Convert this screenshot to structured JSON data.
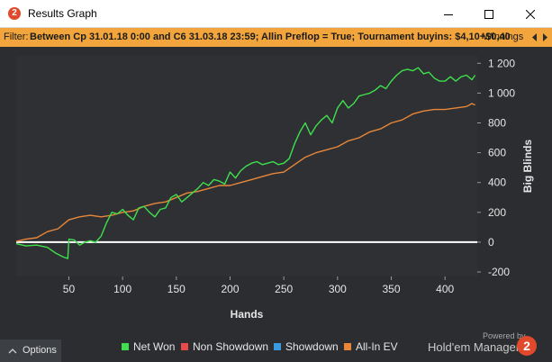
{
  "window": {
    "title": "Results Graph",
    "logo_text": "2"
  },
  "filter": {
    "label": "Filter:",
    "text": "Between Cp 31.01.18 0:00 and C6 31.03.18 23:59; Allin Preflop = True; Tournament buyins: $4,10+$0,40",
    "extra": "Winnings"
  },
  "footer": {
    "options_label": "Options",
    "powered_by": "Powered by",
    "brand": "Hold'em Manager",
    "brand_logo_text": "2",
    "legend": [
      {
        "label": "Net Won",
        "color": "#3ee04d"
      },
      {
        "label": "Non Showdown",
        "color": "#e84a4a"
      },
      {
        "label": "Showdown",
        "color": "#3a9ae0"
      },
      {
        "label": "All-In EV",
        "color": "#e8873a"
      }
    ]
  },
  "chart_data": {
    "type": "line",
    "xlabel": "Hands",
    "ylabel": "Big Blinds",
    "xlim": [
      1,
      430
    ],
    "ylim": [
      -230,
      1250
    ],
    "x_ticks": [
      50,
      100,
      150,
      200,
      250,
      300,
      350,
      400
    ],
    "y_ticks": [
      -200,
      0,
      200,
      400,
      600,
      800,
      1000,
      1200
    ],
    "y_tick_labels": [
      "-200",
      "0",
      "200",
      "400",
      "600",
      "800",
      "1 000",
      "1 200"
    ],
    "grid": false,
    "zero_line": true,
    "series": [
      {
        "name": "Net Won",
        "color": "#3ee04d",
        "x": [
          1,
          10,
          20,
          30,
          38,
          45,
          49,
          50,
          55,
          60,
          65,
          70,
          75,
          80,
          85,
          90,
          95,
          100,
          105,
          110,
          115,
          120,
          125,
          130,
          135,
          140,
          145,
          150,
          155,
          160,
          165,
          170,
          175,
          180,
          185,
          190,
          195,
          200,
          205,
          210,
          215,
          220,
          225,
          230,
          235,
          240,
          245,
          250,
          255,
          260,
          265,
          270,
          275,
          280,
          285,
          290,
          295,
          300,
          305,
          310,
          315,
          320,
          325,
          330,
          335,
          340,
          345,
          350,
          355,
          360,
          365,
          370,
          375,
          380,
          385,
          390,
          395,
          400,
          405,
          410,
          415,
          420,
          425,
          428
        ],
        "values": [
          -10,
          -25,
          -20,
          -35,
          -75,
          -100,
          -110,
          20,
          15,
          -20,
          0,
          10,
          0,
          40,
          130,
          200,
          190,
          220,
          180,
          150,
          230,
          240,
          200,
          170,
          220,
          230,
          300,
          320,
          270,
          300,
          330,
          360,
          400,
          380,
          420,
          410,
          390,
          470,
          430,
          480,
          510,
          530,
          540,
          520,
          530,
          540,
          520,
          530,
          560,
          660,
          740,
          800,
          720,
          780,
          820,
          850,
          800,
          900,
          950,
          900,
          930,
          980,
          990,
          1000,
          1020,
          1050,
          1030,
          1080,
          1120,
          1150,
          1160,
          1150,
          1170,
          1130,
          1140,
          1100,
          1080,
          1080,
          1110,
          1080,
          1110,
          1120,
          1090,
          1120
        ]
      },
      {
        "name": "All-In EV",
        "color": "#e8873a",
        "x": [
          1,
          10,
          20,
          30,
          40,
          50,
          60,
          70,
          80,
          90,
          100,
          110,
          120,
          130,
          140,
          150,
          160,
          170,
          180,
          190,
          200,
          210,
          220,
          230,
          240,
          250,
          260,
          270,
          280,
          290,
          300,
          310,
          320,
          330,
          340,
          350,
          360,
          370,
          380,
          390,
          400,
          410,
          420,
          425,
          428
        ],
        "values": [
          5,
          20,
          30,
          70,
          90,
          150,
          170,
          180,
          170,
          180,
          200,
          210,
          240,
          260,
          270,
          300,
          330,
          340,
          360,
          380,
          380,
          400,
          420,
          440,
          460,
          470,
          520,
          570,
          600,
          620,
          640,
          680,
          700,
          740,
          760,
          800,
          820,
          860,
          880,
          890,
          890,
          900,
          910,
          930,
          920
        ]
      }
    ]
  }
}
